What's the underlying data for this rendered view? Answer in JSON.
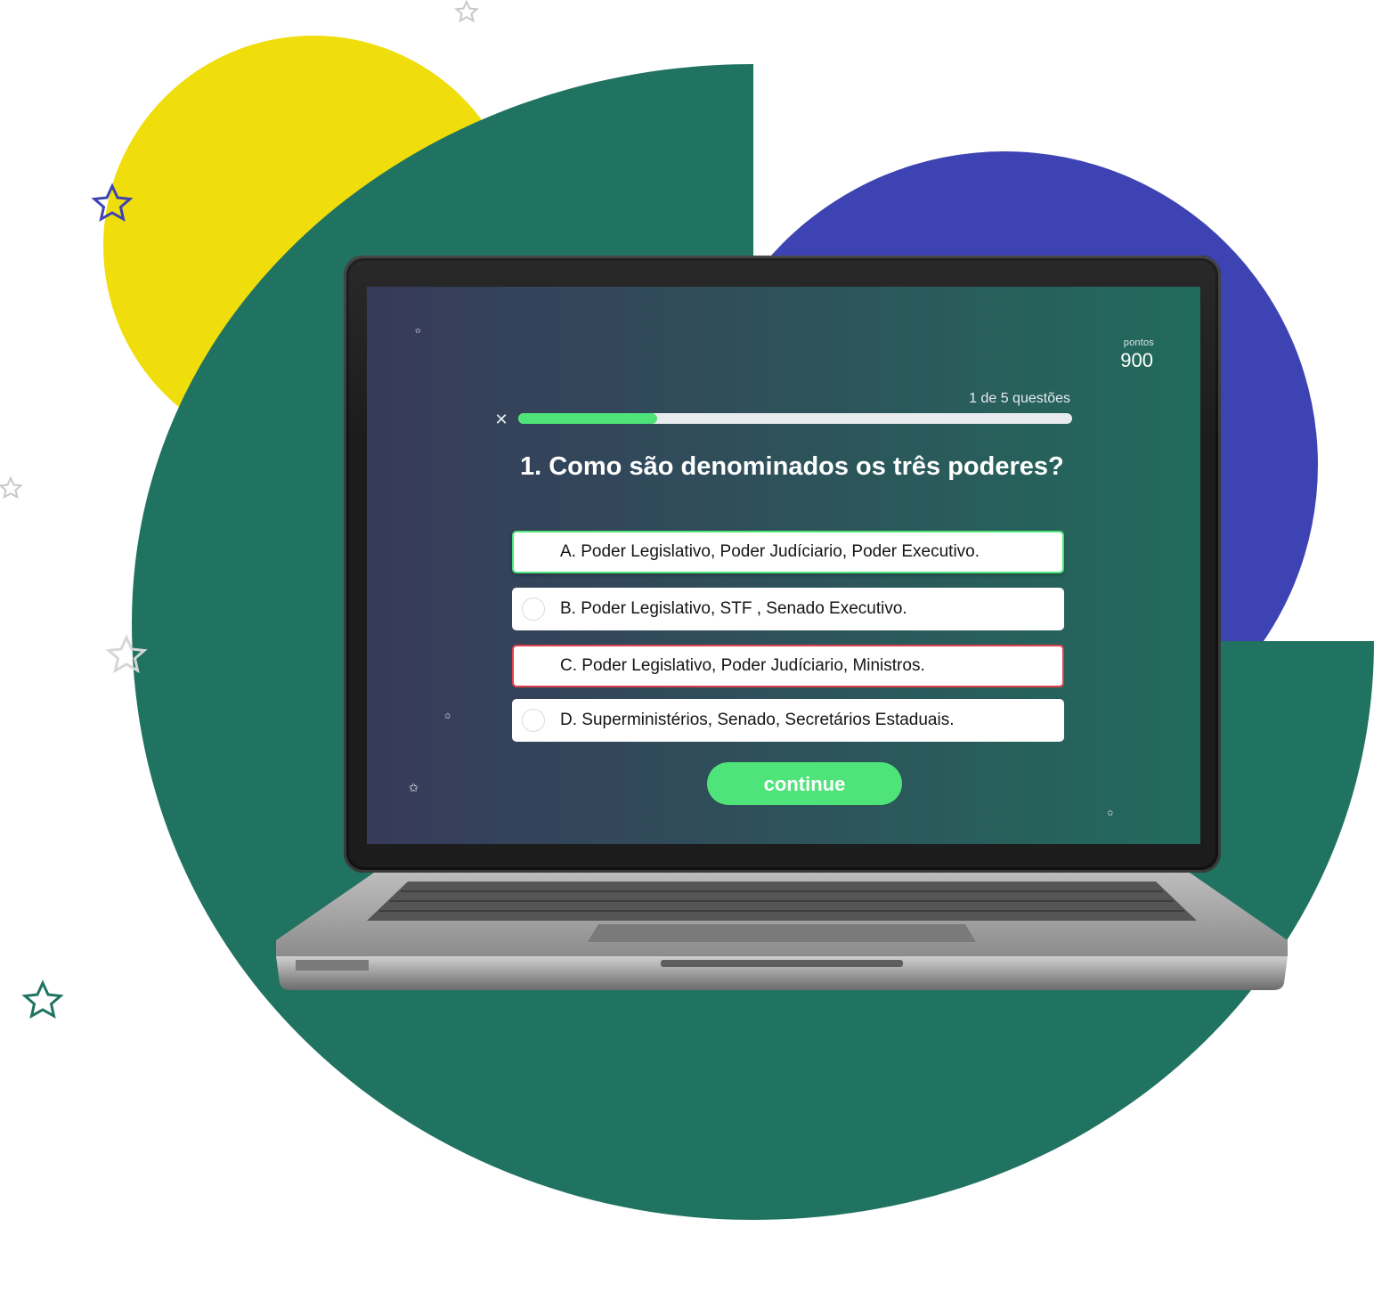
{
  "colors": {
    "yellow": "#efdd0c",
    "green": "#1f7360",
    "blue": "#3e43b3",
    "accent": "#4fe47a",
    "wrong": "#e0404a"
  },
  "score": {
    "label": "pontos",
    "value": "900"
  },
  "progress": {
    "text": "1 de 5 questões",
    "current": 1,
    "total": 5,
    "fraction": 0.25
  },
  "question": {
    "text": "1. Como são denominados os três poderes?"
  },
  "options": [
    {
      "text": "A. Poder Legislativo, Poder Judíciario, Poder Executivo.",
      "state": "correct"
    },
    {
      "text": "B. Poder Legislativo, STF , Senado Executivo.",
      "state": "default"
    },
    {
      "text": "C. Poder Legislativo, Poder Judíciario, Ministros.",
      "state": "wrong"
    },
    {
      "text": "D. Superministérios, Senado, Secretários Estaduais.",
      "state": "default"
    }
  ],
  "continue_label": "continue",
  "icons": {
    "close": "close-icon",
    "star": "star-icon",
    "radio": "radio-icon"
  }
}
